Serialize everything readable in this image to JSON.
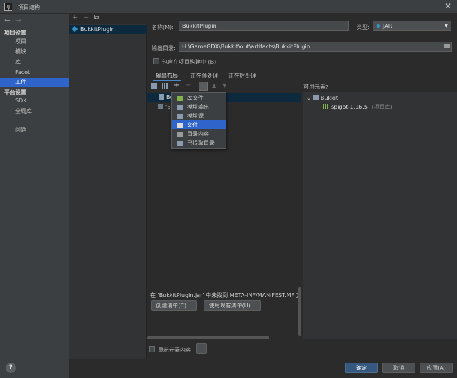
{
  "window": {
    "icon_text": "IJ",
    "title": "项目结构",
    "close": "✕"
  },
  "nav": {
    "back": "←",
    "forward": "→",
    "project_settings_header": "项目设置",
    "project_settings": [
      "项目",
      "模块",
      "库",
      "Facet",
      "工件"
    ],
    "platform_header": "平台设置",
    "platform": [
      "SDK",
      "全局库"
    ],
    "problems": "问题",
    "selected": "工件"
  },
  "artifact_list": {
    "add": "+",
    "remove": "−",
    "copy": "⧉",
    "items": [
      "BukkitPlugin"
    ]
  },
  "form": {
    "name_label": "名称(M):",
    "name_value": "BukkitPlugin",
    "type_label": "类型:",
    "type_value": "JAR",
    "output_label": "输出目录:",
    "output_value": "H:\\GameGDX\\Bukkit\\out\\artifacts\\BukkitPlugin",
    "include_in_build": "包含在项目构建中 (B)"
  },
  "tabs": [
    "输出布局",
    "正在预处理",
    "正在后处理"
  ],
  "layout_tree": {
    "root": "Bukk",
    "child": "'B"
  },
  "popup_menu": {
    "items": [
      "库文件",
      "模块输出",
      "模块源",
      "文件",
      "目录内容",
      "已提取目录"
    ],
    "selected": "文件"
  },
  "available": {
    "title": "可用元素",
    "help": "?",
    "group": "Bukkit",
    "lib_name": "spigot-1.16.5",
    "lib_suffix": "(项目库)"
  },
  "manifest": {
    "message": "在 'BukkitPlugin.jar' 中未找到 META-INF/MANIFEST.MF 文件",
    "create_btn": "创建清单(C)...",
    "use_existing_btn": "使用现有清单(U)..."
  },
  "show_content": "显示元素内容",
  "more_btn": "...",
  "footer": {
    "help": "?",
    "ok": "确定",
    "cancel": "取消",
    "apply": "应用(A)"
  },
  "colors": {
    "accent": "#2f65ca",
    "selection_dark": "#0d293e",
    "ok_button": "#365880"
  }
}
